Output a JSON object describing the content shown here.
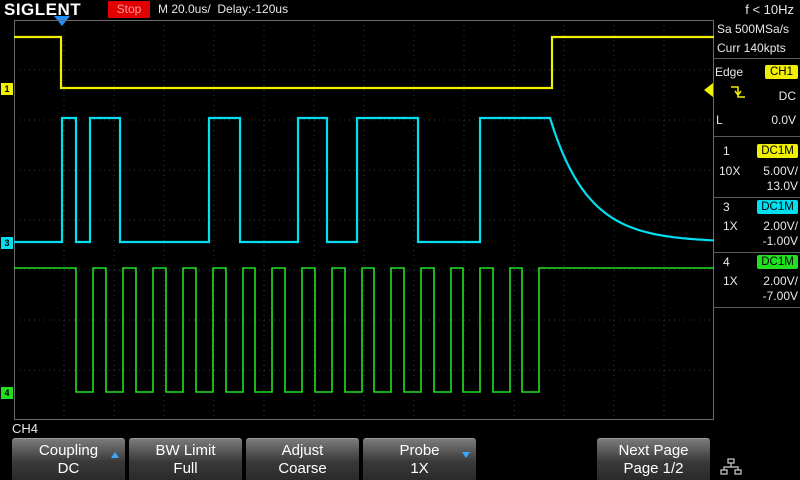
{
  "header": {
    "brand": "SIGLENT",
    "run_state": "Stop",
    "timebase": "M 20.0us/",
    "delay": "Delay:-120us",
    "frequency": "f < 10Hz"
  },
  "acquisition": {
    "sample_rate": "Sa 500MSa/s",
    "memory": "Curr 140kpts"
  },
  "trigger": {
    "type": "Edge",
    "source": "CH1",
    "coupling": "DC",
    "level_label": "L",
    "level": "0.0V",
    "slope_icon": "falling-edge-icon"
  },
  "channels": [
    {
      "number": "1",
      "coupling": "DC1M",
      "probe": "10X",
      "scale": "5.00V/",
      "offset": "13.0V",
      "color": "#f0f000"
    },
    {
      "number": "3",
      "coupling": "DC1M",
      "probe": "1X",
      "scale": "2.00V/",
      "offset": "-1.00V",
      "color": "#00e0f0"
    },
    {
      "number": "4",
      "coupling": "DC1M",
      "probe": "1X",
      "scale": "2.00V/",
      "offset": "-7.00V",
      "color": "#20e020"
    }
  ],
  "menu": {
    "channel_label": "CH4",
    "softkeys": [
      {
        "title": "Coupling",
        "value": "DC"
      },
      {
        "title": "BW Limit",
        "value": "Full"
      },
      {
        "title": "Adjust",
        "value": "Coarse"
      },
      {
        "title": "Probe",
        "value": "1X"
      },
      {
        "title": "Next Page",
        "value": "Page 1/2"
      }
    ],
    "network_icon": "network-icon"
  }
}
